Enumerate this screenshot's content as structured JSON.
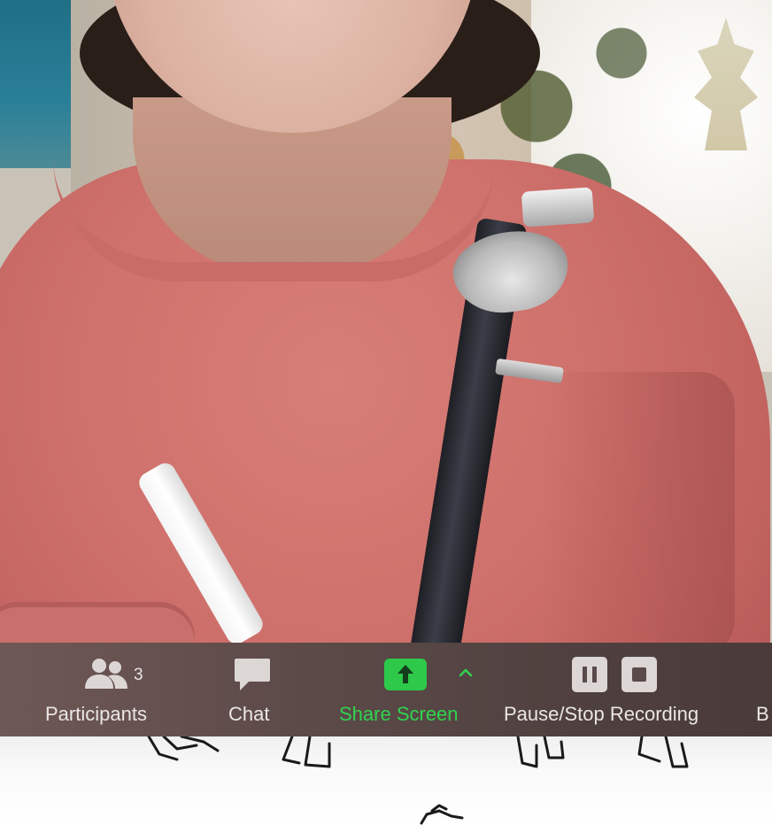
{
  "window": {
    "type": "video-call"
  },
  "video": {
    "content": "participant-video-feed"
  },
  "toolbar": {
    "participants": {
      "label": "Participants",
      "count": "3",
      "icon": "participants-icon"
    },
    "chat": {
      "label": "Chat",
      "icon": "chat-bubble-icon"
    },
    "share_screen": {
      "label": "Share Screen",
      "icon": "share-screen-arrow-icon",
      "options_icon": "chevron-up-icon",
      "color": "#31d34f"
    },
    "recording": {
      "label": "Pause/Stop Recording",
      "pause_icon": "pause-icon",
      "stop_icon": "stop-icon"
    },
    "truncated_next": {
      "label": "B"
    },
    "colors": {
      "text": "#eae6e5",
      "background": "#5c4a48"
    }
  }
}
